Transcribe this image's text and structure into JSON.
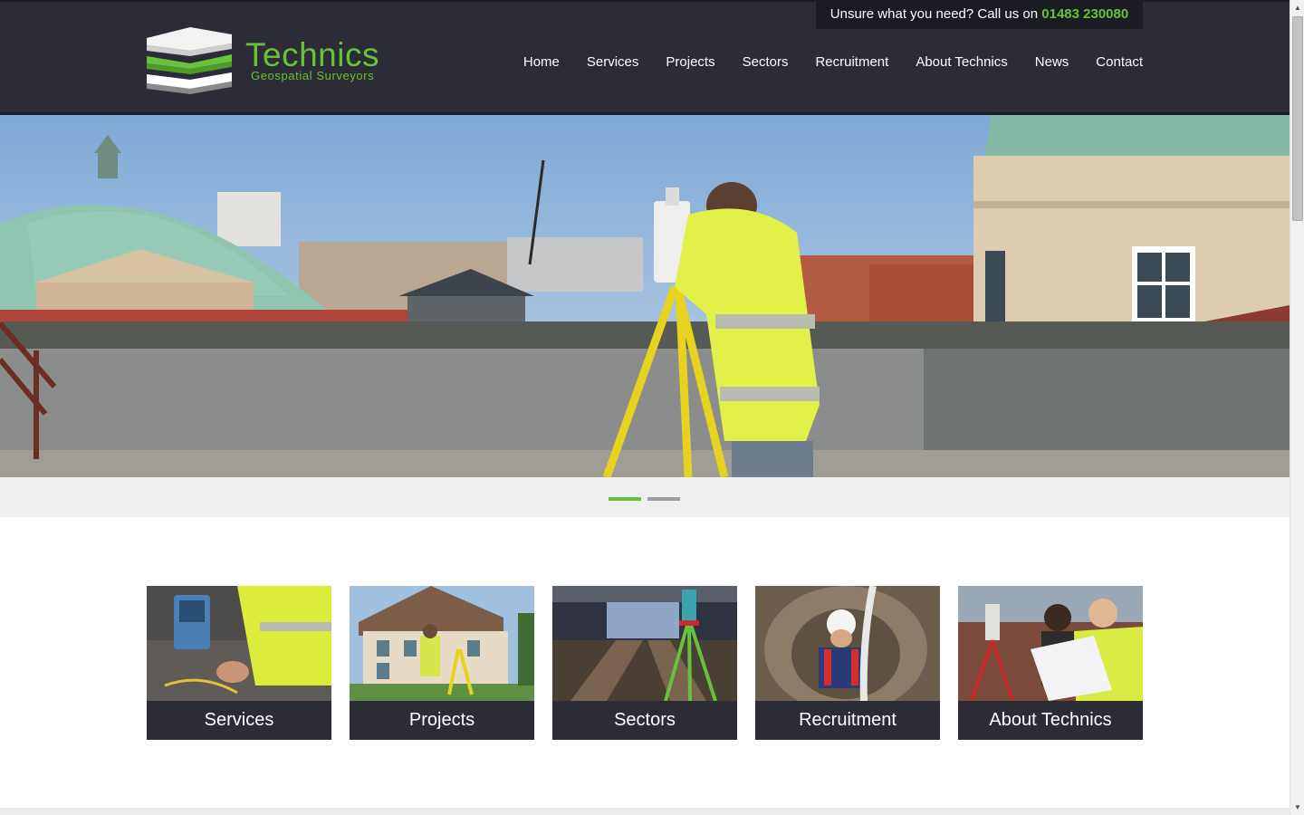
{
  "callbar": {
    "text": "Unsure what you need? Call us on",
    "phone": "01483 230080"
  },
  "logo": {
    "title": "Technics",
    "subtitle": "Geospatial Surveyors"
  },
  "nav": {
    "items": [
      "Home",
      "Services",
      "Projects",
      "Sectors",
      "Recruitment",
      "About Technics",
      "News",
      "Contact"
    ]
  },
  "slider": {
    "slides_count": 2,
    "active_slide": 1
  },
  "tiles": [
    {
      "label": "Services"
    },
    {
      "label": "Projects"
    },
    {
      "label": "Sectors"
    },
    {
      "label": "Recruitment"
    },
    {
      "label": "About Technics"
    }
  ],
  "colors": {
    "header_bg": "#2b2c36",
    "accent_green": "#69c13a",
    "slider_strip": "#efeff0"
  },
  "icons": {
    "scroll_up": "scroll-up-arrow-icon",
    "scroll_down": "scroll-down-arrow-icon"
  }
}
